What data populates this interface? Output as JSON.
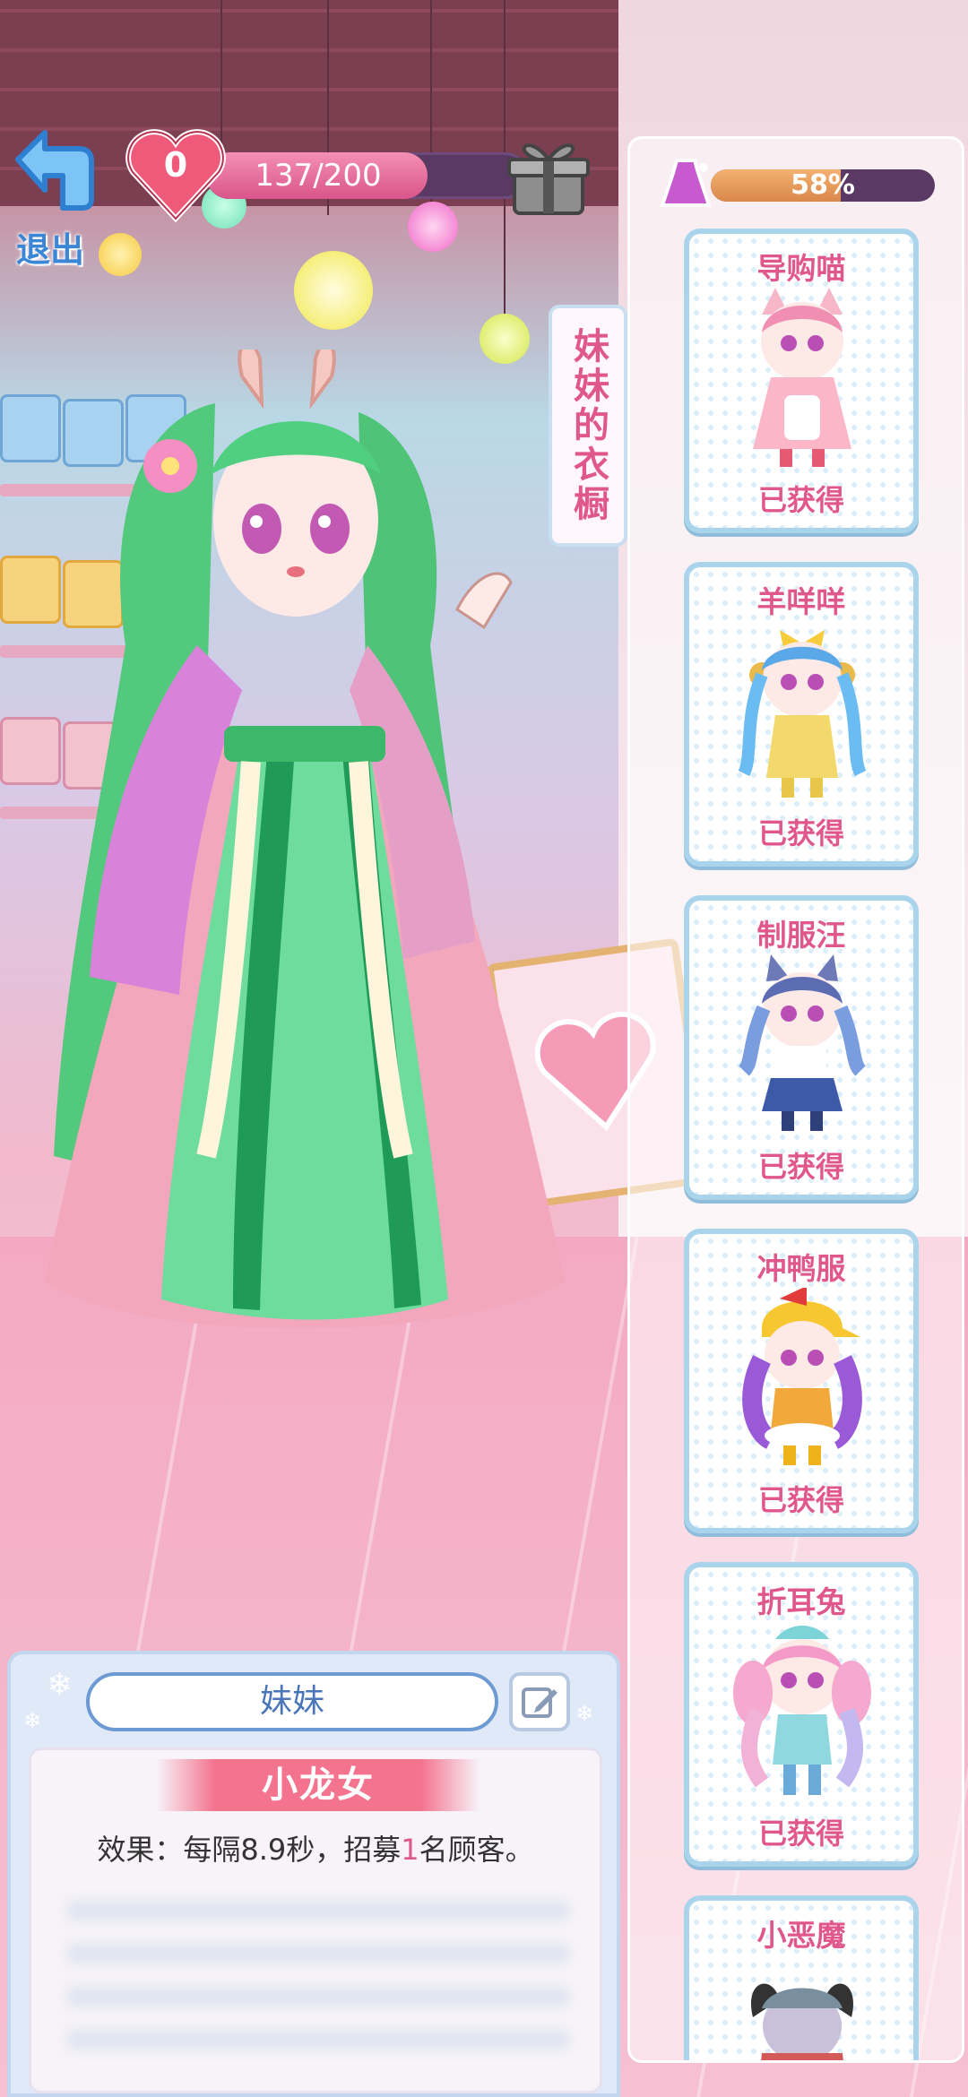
{
  "hud": {
    "back_label": "退出",
    "hearts": "0",
    "progress_text": "137/200",
    "progress_fraction": 0.685
  },
  "wardrobe_tab": "妹妹的衣橱",
  "panel": {
    "completion_text": "58%",
    "completion_fraction": 0.58,
    "outfits": [
      {
        "name": "导购喵",
        "status": "已获得"
      },
      {
        "name": "羊咩咩",
        "status": "已获得"
      },
      {
        "name": "制服汪",
        "status": "已获得"
      },
      {
        "name": "冲鸭服",
        "status": "已获得"
      },
      {
        "name": "折耳兔",
        "status": "已获得"
      },
      {
        "name": "小恶魔",
        "status": ""
      }
    ]
  },
  "info": {
    "character_name": "妹妹",
    "outfit_title": "小龙女",
    "effect_prefix": "效果：每隔8.9秒，招募",
    "effect_number": "1",
    "effect_suffix": "名顾客。"
  },
  "colors": {
    "accent_pink": "#e0578c",
    "accent_blue": "#4a75b9",
    "card_border": "#a9d4ec"
  }
}
